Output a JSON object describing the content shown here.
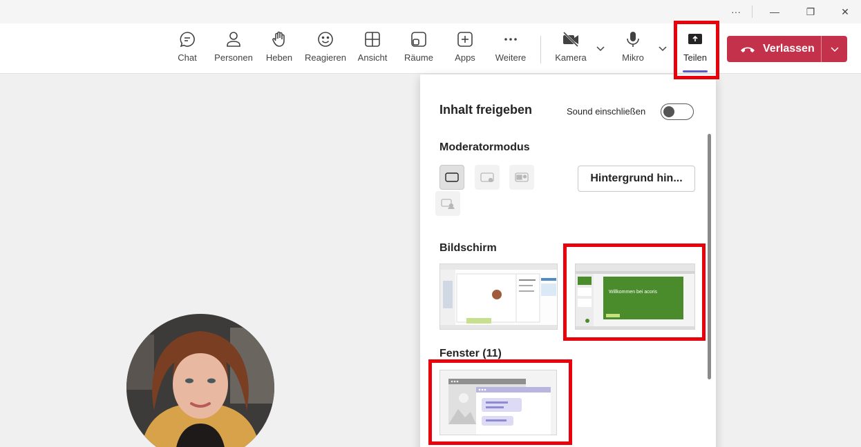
{
  "titlebar": {
    "more": "···",
    "minimize": "—",
    "restore": "❐",
    "close": "✕"
  },
  "toolbar": {
    "items": [
      {
        "label": "Chat",
        "icon": "chat-icon"
      },
      {
        "label": "Personen",
        "icon": "people-icon"
      },
      {
        "label": "Heben",
        "icon": "raise-hand-icon"
      },
      {
        "label": "Reagieren",
        "icon": "emoji-icon"
      },
      {
        "label": "Ansicht",
        "icon": "grid-view-icon"
      },
      {
        "label": "Räume",
        "icon": "rooms-icon"
      },
      {
        "label": "Apps",
        "icon": "add-apps-icon"
      },
      {
        "label": "Weitere",
        "icon": "more-icon"
      },
      {
        "label": "Kamera",
        "icon": "camera-off-icon"
      },
      {
        "label": "Mikro",
        "icon": "microphone-icon"
      },
      {
        "label": "Teilen",
        "icon": "share-screen-icon"
      }
    ],
    "leave_label": "Verlassen"
  },
  "share_panel": {
    "title": "Inhalt freigeben",
    "sound_label": "Sound einschließen",
    "sound_on": false,
    "presenter_mode_title": "Moderatormodus",
    "background_button": "Hintergrund hin...",
    "screen_title": "Bildschirm",
    "windows_title": "Fenster (11)",
    "slide_title": "Willkommen bei acoris"
  },
  "colors": {
    "accent": "#5b5fc7",
    "leave": "#c4314b",
    "highlight": "#e8000b",
    "slide_green": "#4a8b2c"
  }
}
